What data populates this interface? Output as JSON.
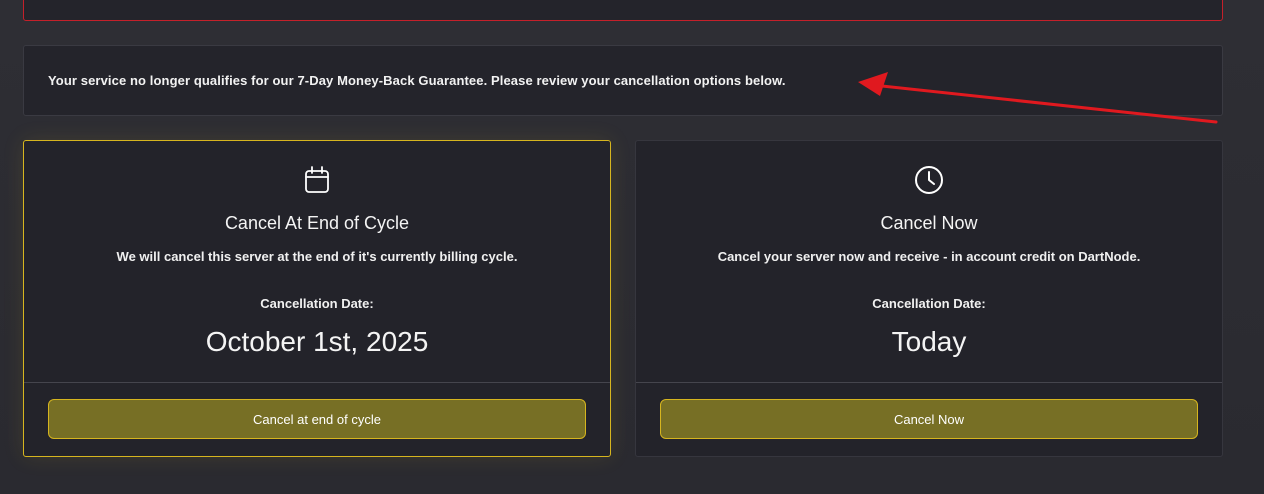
{
  "notice": {
    "text": "Your service no longer qualifies for our 7-Day Money-Back Guarantee. Please review your cancellation options below."
  },
  "options": [
    {
      "icon": "calendar-icon",
      "title": "Cancel At End of Cycle",
      "description": "We will cancel this server at the end of it's currently billing cycle.",
      "date_label": "Cancellation Date:",
      "date": "October 1st, 2025",
      "button_label": "Cancel at end of cycle",
      "selected": true
    },
    {
      "icon": "clock-icon",
      "title": "Cancel Now",
      "description": "Cancel your server now and receive - in account credit on DartNode.",
      "date_label": "Cancellation Date:",
      "date": "Today",
      "button_label": "Cancel Now",
      "selected": false
    }
  ],
  "colors": {
    "accent": "#d6b51f",
    "button_bg": "#776f25",
    "alert_border": "#c4202a",
    "arrow": "#e0191f"
  }
}
